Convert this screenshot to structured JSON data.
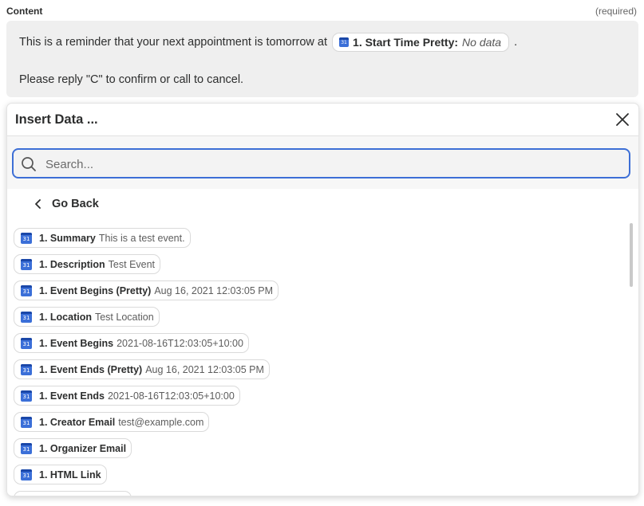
{
  "field": {
    "label": "Content",
    "required": "(required)",
    "line1_before": "This is a reminder that your next appointment is tomorrow at",
    "line1_after": ".",
    "pill_key": "1. Start Time Pretty:",
    "pill_value": "No data",
    "line2": "Please reply \"C\" to confirm or call to cancel."
  },
  "panel": {
    "title": "Insert Data ...",
    "search_placeholder": "Search...",
    "go_back": "Go Back",
    "items": [
      {
        "key": "1. Summary",
        "value": "This is a test event."
      },
      {
        "key": "1. Description",
        "value": "Test Event"
      },
      {
        "key": "1. Event Begins (Pretty)",
        "value": "Aug 16, 2021 12:03:05 PM"
      },
      {
        "key": "1. Location",
        "value": "Test Location"
      },
      {
        "key": "1. Event Begins",
        "value": "2021-08-16T12:03:05+10:00"
      },
      {
        "key": "1. Event Ends (Pretty)",
        "value": "Aug 16, 2021 12:03:05 PM"
      },
      {
        "key": "1. Event Ends",
        "value": "2021-08-16T12:03:05+10:00"
      },
      {
        "key": "1. Creator Email",
        "value": "test@example.com"
      },
      {
        "key": "1. Organizer Email",
        "value": ""
      },
      {
        "key": "1. HTML Link",
        "value": ""
      }
    ]
  },
  "icons": {
    "item_icon": "google-calendar-icon",
    "search": "search-icon",
    "close": "close-icon",
    "back": "chevron-left-icon"
  },
  "colors": {
    "accent": "#3d6fd6",
    "calendar": "#3b6fd8",
    "content_bg": "#efefef"
  }
}
